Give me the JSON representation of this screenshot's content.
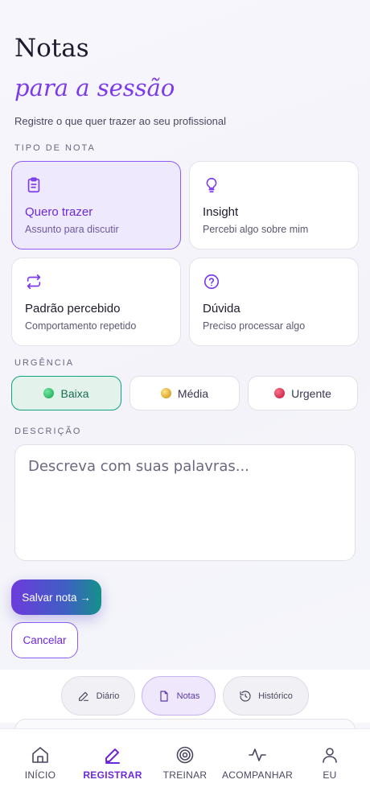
{
  "header": {
    "title": "Notas",
    "subtitle": "para a sessão",
    "lead": "Registre o que quer trazer ao seu profissional"
  },
  "note_type": {
    "label": "TIPO DE NOTA",
    "options": [
      {
        "title": "Quero trazer",
        "desc": "Assunto para discutir",
        "icon": "clipboard-icon",
        "selected": true
      },
      {
        "title": "Insight",
        "desc": "Percebi algo sobre mim",
        "icon": "lightbulb-icon",
        "selected": false
      },
      {
        "title": "Padrão percebido",
        "desc": "Comportamento repetido",
        "icon": "repeat-icon",
        "selected": false
      },
      {
        "title": "Dúvida",
        "desc": "Preciso processar algo",
        "icon": "question-icon",
        "selected": false
      }
    ]
  },
  "urgency": {
    "label": "URGÊNCIA",
    "options": [
      {
        "label": "Baixa",
        "color": "#22c55e",
        "selected": true
      },
      {
        "label": "Média",
        "color": "#eab308",
        "selected": false
      },
      {
        "label": "Urgente",
        "color": "#e11d48",
        "selected": false
      }
    ]
  },
  "description": {
    "label": "DESCRIÇÃO",
    "placeholder": "Descreva com suas palavras...",
    "value": ""
  },
  "actions": {
    "save": "Salvar nota →",
    "cancel": "Cancelar"
  },
  "subnav": {
    "items": [
      {
        "label": "Diário",
        "icon": "pencil-icon",
        "selected": false
      },
      {
        "label": "Notas",
        "icon": "document-icon",
        "selected": true
      },
      {
        "label": "Histórico",
        "icon": "history-icon",
        "selected": false
      }
    ]
  },
  "bottom_nav": {
    "items": [
      {
        "label": "INÍCIO",
        "icon": "home-icon",
        "active": false
      },
      {
        "label": "REGISTRAR",
        "icon": "pen-icon",
        "active": true
      },
      {
        "label": "TREINAR",
        "icon": "target-icon",
        "active": false
      },
      {
        "label": "ACOMPANHAR",
        "icon": "pulse-icon",
        "active": false
      },
      {
        "label": "EU",
        "icon": "user-icon",
        "active": false
      }
    ]
  },
  "colors": {
    "accent": "#7c3aed",
    "selected_bg": "#efe9fd",
    "urgency_selected": "#10a37a"
  }
}
